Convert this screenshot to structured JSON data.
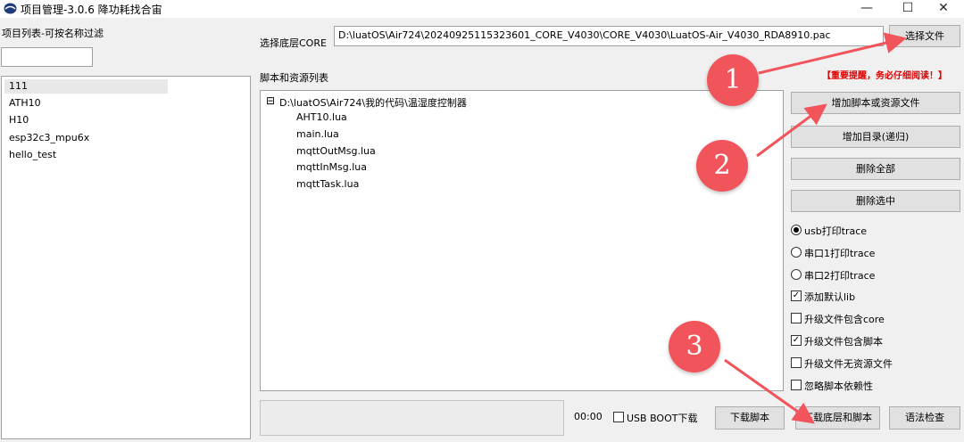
{
  "window": {
    "title": "项目管理-3.0.6 降功耗找合宙",
    "min_label": "—",
    "max_label": "☐",
    "close_label": "✕"
  },
  "left_panel": {
    "filter_label": "项目列表-可按名称过滤",
    "filter_value": "",
    "projects": [
      "111",
      "ATH10",
      "H10",
      "esp32c3_mpu6x",
      "hello_test"
    ],
    "selected_index": 0
  },
  "core": {
    "label": "选择底层CORE",
    "path": "D:\\luatOS\\Air724\\20240925115323601_CORE_V4030\\CORE_V4030\\LuatOS-Air_V4030_RDA8910.pac",
    "select_button": "选择文件"
  },
  "notice": "【重要提醒，务必仔细阅读！】",
  "scripts": {
    "label": "脚本和资源列表",
    "tree_root_toggle": "⊟",
    "root": "D:\\luatOS\\Air724\\我的代码\\温湿度控制器",
    "files": [
      "AHT10.lua",
      "main.lua",
      "mqttOutMsg.lua",
      "mqttInMsg.lua",
      "mqttTask.lua"
    ]
  },
  "right_buttons": {
    "add_files": "增加脚本或资源文件",
    "add_dir": "增加目录(递归)",
    "delete_all": "删除全部",
    "delete_selected": "删除选中"
  },
  "options": [
    {
      "type": "radio",
      "label": "usb打印trace",
      "checked": true
    },
    {
      "type": "radio",
      "label": "串口1打印trace",
      "checked": false
    },
    {
      "type": "radio",
      "label": "串口2打印trace",
      "checked": false
    },
    {
      "type": "checkbox",
      "label": "添加默认lib",
      "checked": true
    },
    {
      "type": "checkbox",
      "label": "升级文件包含core",
      "checked": false
    },
    {
      "type": "checkbox",
      "label": "升级文件包含脚本",
      "checked": true
    },
    {
      "type": "checkbox",
      "label": "升级文件无资源文件",
      "checked": false
    },
    {
      "type": "checkbox",
      "label": "忽略脚本依赖性",
      "checked": false
    }
  ],
  "bottom": {
    "time": "00:00",
    "usb_boot_label": "USB BOOT下载",
    "usb_boot_checked": false,
    "download_script": "下载脚本",
    "download_core_script": "下载底层和脚本",
    "syntax_check": "语法检查"
  },
  "annotations": {
    "n1": "1",
    "n2": "2",
    "n3": "3",
    "color": "#f2545b"
  }
}
